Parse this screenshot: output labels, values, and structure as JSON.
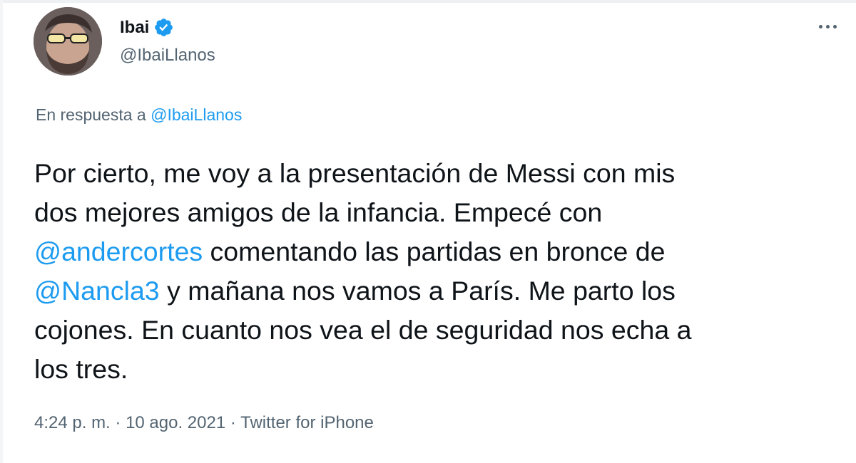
{
  "author": {
    "name": "Ibai",
    "handle": "@IbaiLlanos",
    "avatar_icon": "avatar-photo",
    "verified_icon": "verified-badge-icon",
    "verified_color": "#1d9bf0"
  },
  "more_icon": "more-options-icon",
  "reply_context": {
    "prefix": "En respuesta a ",
    "handle": "@IbaiLlanos"
  },
  "tweet": {
    "lines": [
      [
        {
          "text": "Por cierto, me voy a la presentación de Messi con mis",
          "mention": false
        }
      ],
      [
        {
          "text": "dos mejores amigos de la infancia. Empecé con",
          "mention": false
        }
      ],
      [
        {
          "text": "@andercortes",
          "mention": true
        },
        {
          "text": " comentando las partidas en bronce de",
          "mention": false
        }
      ],
      [
        {
          "text": "@Nancla3",
          "mention": true
        },
        {
          "text": " y mañana nos vamos a París. Me parto los",
          "mention": false
        }
      ],
      [
        {
          "text": "cojones. En cuanto nos vea el de seguridad nos echa a",
          "mention": false
        }
      ],
      [
        {
          "text": "los tres.",
          "mention": false
        }
      ]
    ]
  },
  "meta": {
    "time": "4:24 p. m.",
    "sep1": " · ",
    "date": "10 ago. 2021",
    "sep2": " · ",
    "source": "Twitter for iPhone"
  },
  "colors": {
    "text": "#0f1419",
    "secondary": "#536471",
    "link": "#1d9bf0"
  }
}
